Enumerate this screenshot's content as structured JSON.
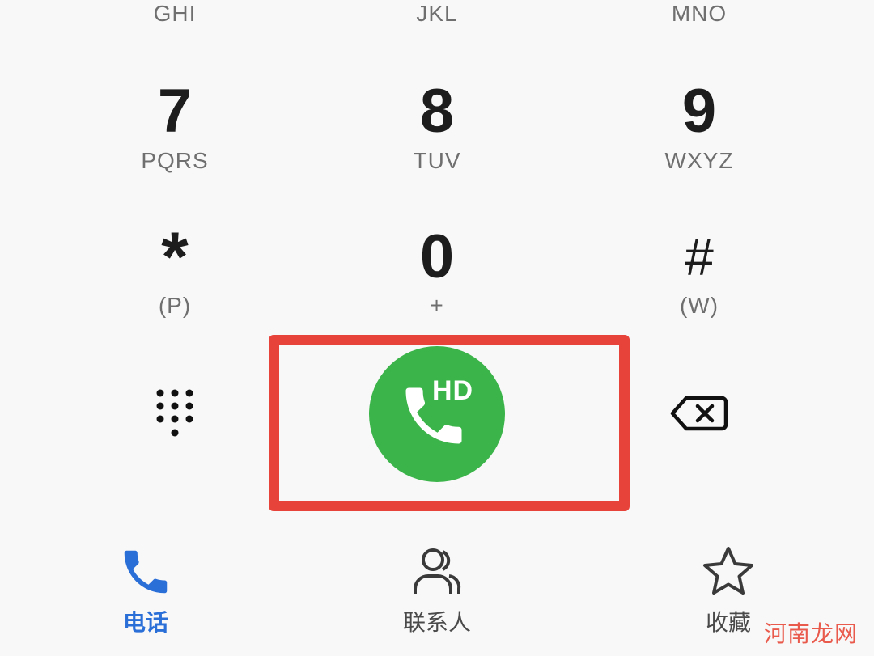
{
  "keypad": {
    "top_letters": [
      "GHI",
      "JKL",
      "MNO"
    ],
    "row_7": [
      {
        "digit": "7",
        "letters": "PQRS"
      },
      {
        "digit": "8",
        "letters": "TUV"
      },
      {
        "digit": "9",
        "letters": "WXYZ"
      }
    ],
    "row_0": [
      {
        "digit": "*",
        "letters": "(P)"
      },
      {
        "digit": "0",
        "letters": "+"
      },
      {
        "digit": "#",
        "letters": "(W)"
      }
    ]
  },
  "call_button": {
    "badge": "HD",
    "color": "#3bb449"
  },
  "highlight": {
    "color": "#e8433a"
  },
  "icons": {
    "dialpad": "dialpad-icon",
    "backspace": "backspace-icon",
    "call": "phone-icon",
    "contacts": "contacts-icon",
    "favorites": "star-icon"
  },
  "bottom_nav": {
    "items": [
      {
        "label": "电话",
        "active": true,
        "color": "#2a6ed8"
      },
      {
        "label": "联系人",
        "active": false
      },
      {
        "label": "收藏",
        "active": false
      }
    ]
  },
  "watermark": "河南龙网"
}
